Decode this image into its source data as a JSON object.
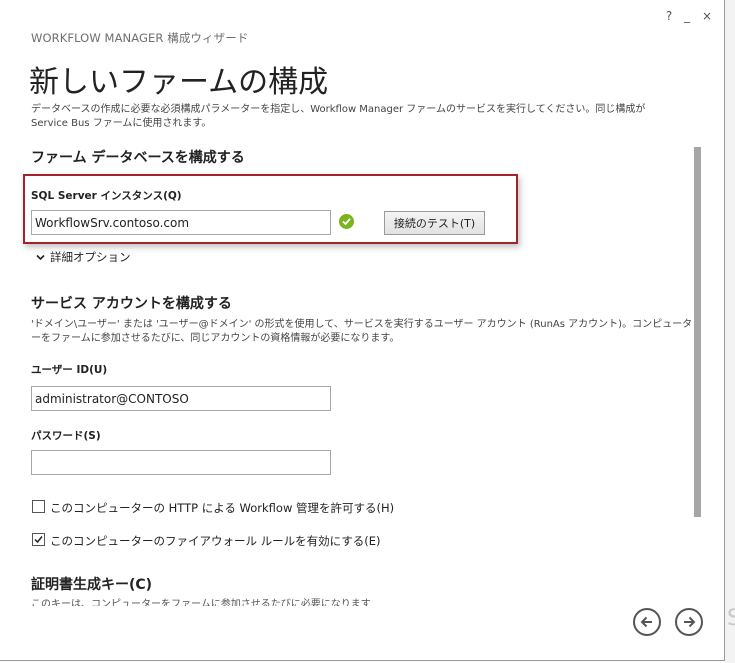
{
  "window": {
    "app_title": "WORKFLOW MANAGER 構成ウィザード",
    "help": "?",
    "minimize": "_",
    "close": "×"
  },
  "page": {
    "title": "新しいファームの構成",
    "description": "データベースの作成に必要な必須構成パラメーターを指定し、Workflow Manager ファームのサービスを実行してください。同じ構成が Service Bus ファームに使用されます。"
  },
  "db_section": {
    "heading": "ファーム データベースを構成する",
    "sql_label": "SQL Server インスタンス(Q)",
    "sql_value": "WorkflowSrv.contoso.com",
    "status_icon": "check-circle-icon",
    "test_button": "接続のテスト(T)",
    "advanced_options": "詳細オプション"
  },
  "svc_section": {
    "heading": "サービス アカウントを構成する",
    "description": "'ドメイン\\ユーザー' または 'ユーザー@ドメイン' の形式を使用して、サービスを実行するユーザー アカウント (RunAs アカウント)。コンピューターをファームに参加させるたびに、同じアカウントの資格情報が必要になります。",
    "user_label": "ユーザー ID(U)",
    "user_value": "administrator@CONTOSO",
    "password_label": "パスワード(S)",
    "password_value": ""
  },
  "options": {
    "http_label": "このコンピューターの HTTP による Workflow 管理を許可する(H)",
    "http_checked": false,
    "firewall_label": "このコンピューターのファイアウォール ルールを有効にする(E)",
    "firewall_checked": true
  },
  "cert_section": {
    "heading": "証明書生成キー(C)",
    "description": "このキーは、コンピューターをファームに参加させるたびに必要になります"
  },
  "navigation": {
    "back_icon": "arrow-left-circle-icon",
    "next_icon": "arrow-right-circle-icon"
  },
  "colors": {
    "highlight_border": "#a3222b",
    "success_green": "#7ab51d"
  }
}
